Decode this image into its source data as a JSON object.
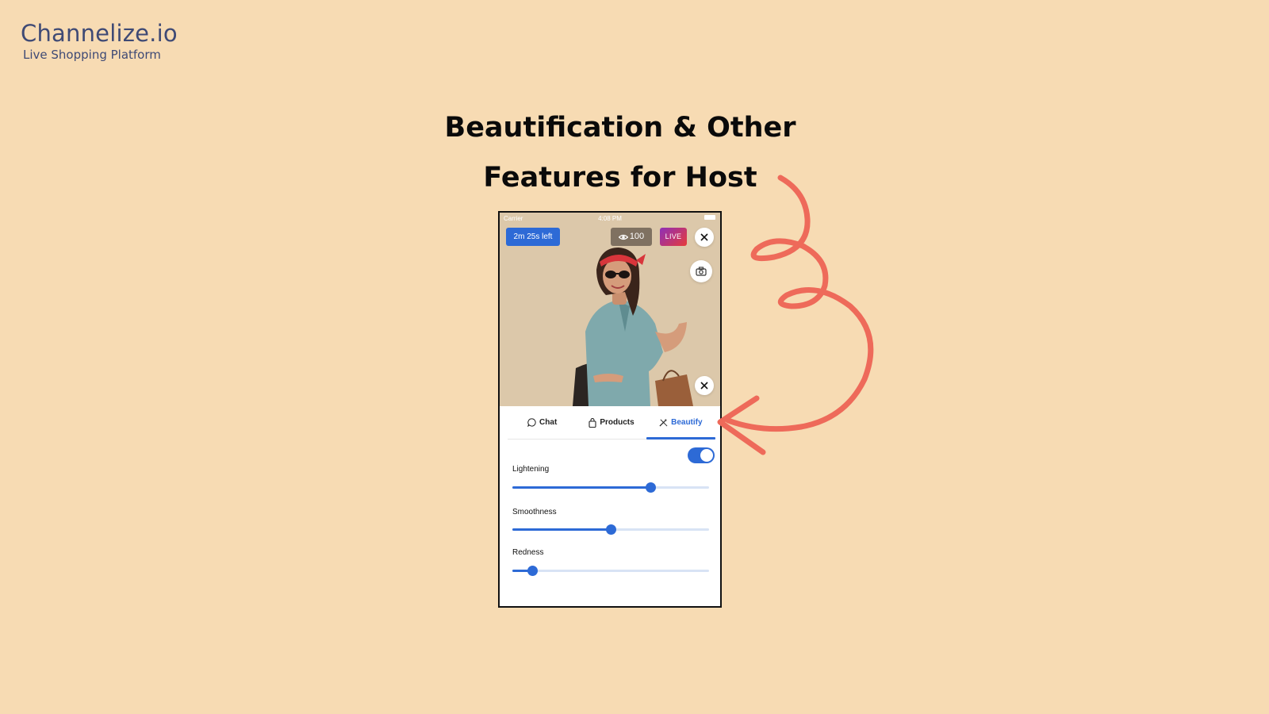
{
  "brand": {
    "name": "Channelize.io",
    "tagline": "Live Shopping Platform",
    "color": "#3f4a75"
  },
  "headline": {
    "line1": "Beautification & Other",
    "line2": "Features for Host"
  },
  "phone": {
    "status_bar": {
      "carrier": "Carrier",
      "time": "4:08 PM"
    },
    "timer": "2m 25s left",
    "viewers": "100",
    "live_label": "LIVE",
    "tabs": [
      {
        "label": "Chat",
        "icon": "chat-bubble-icon",
        "active": false
      },
      {
        "label": "Products",
        "icon": "shopping-bag-icon",
        "active": false
      },
      {
        "label": "Beautify",
        "icon": "magic-wand-icon",
        "active": true
      }
    ],
    "beautify": {
      "enabled": true,
      "sliders": [
        {
          "label": "Lightening",
          "value": 0.7
        },
        {
          "label": "Smoothness",
          "value": 0.5
        },
        {
          "label": "Redness",
          "value": 0.1
        }
      ]
    }
  },
  "colors": {
    "background": "#f7dbb3",
    "accent": "#2d6ad6",
    "arrow": "#ee6a5a"
  }
}
